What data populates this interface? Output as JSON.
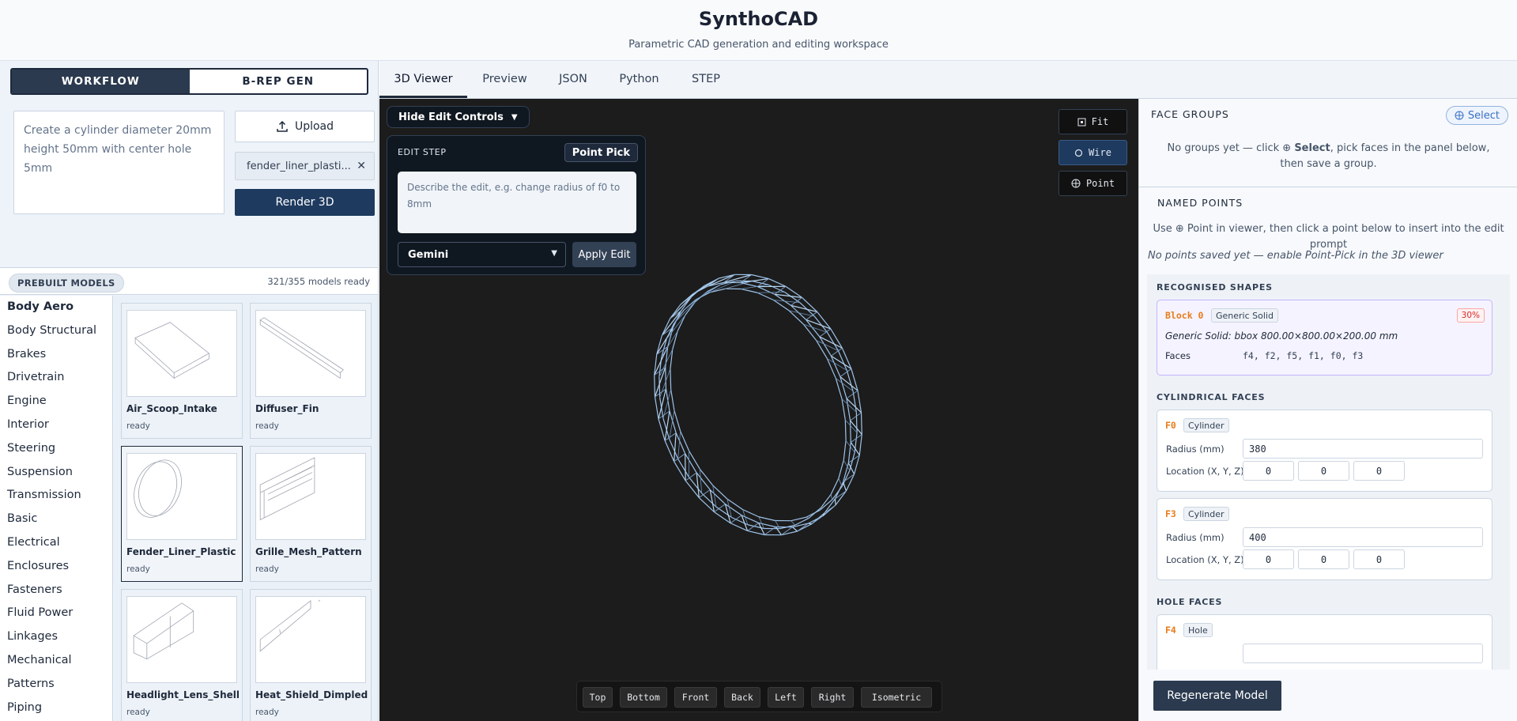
{
  "app": {
    "title": "SynthoCAD",
    "subtitle": "Parametric CAD generation and editing workspace"
  },
  "left": {
    "modes": [
      "WORKFLOW",
      "B-REP GEN"
    ],
    "prompt_text": "Create a cylinder diameter 20mm height 50mm with center hole 5mm",
    "upload_label": "Upload",
    "file_name": "fender_liner_plasti...",
    "file_remove": "✕",
    "render_label": "Render 3D",
    "prebuilt_label": "PREBUILT MODELS",
    "prebuilt_count": "321/355 models ready",
    "categories": [
      "Body Aero",
      "Body Structural",
      "Brakes",
      "Drivetrain",
      "Engine",
      "Interior",
      "Steering",
      "Suspension",
      "Transmission",
      "Basic",
      "Electrical",
      "Enclosures",
      "Fasteners",
      "Fluid Power",
      "Linkages",
      "Mechanical",
      "Patterns",
      "Piping"
    ],
    "models": [
      {
        "name": "Air_Scoop_Intake",
        "status": "ready"
      },
      {
        "name": "Diffuser_Fin",
        "status": "ready"
      },
      {
        "name": "Fender_Liner_Plastic",
        "status": "ready"
      },
      {
        "name": "Grille_Mesh_Pattern",
        "status": "ready"
      },
      {
        "name": "Headlight_Lens_Shell",
        "status": "ready"
      },
      {
        "name": "Heat_Shield_Dimpled",
        "status": "ready"
      }
    ]
  },
  "tabs": [
    "3D Viewer",
    "Preview",
    "JSON",
    "Python",
    "STEP"
  ],
  "viewer": {
    "hide_controls": "Hide Edit Controls",
    "hide_caret": "▼",
    "edit_title": "EDIT STEP",
    "point_pick": "Point Pick",
    "edit_placeholder": "Describe the edit, e.g. change radius of f0 to 8mm",
    "llm_model": "Gemini",
    "apply_label": "Apply Edit",
    "fit_label": "Fit",
    "wire_label": "Wire",
    "point_label": "Point",
    "views": [
      "Top",
      "Bottom",
      "Front",
      "Back",
      "Left",
      "Right",
      "Isometric"
    ]
  },
  "right": {
    "face_groups_title": "FACE GROUPS",
    "select_label": "Select",
    "face_groups_note_1": "No groups yet — click",
    "face_groups_note_2": "Select",
    "face_groups_note_3": ", pick faces in the panel below, then save a",
    "face_groups_note_4": "group.",
    "named_points_title": "NAMED POINTS",
    "named_points_hint_1": "Use",
    "named_points_hint_2": "Point in viewer, then click a point below to insert into the edit prompt",
    "named_points_empty": "No points saved yet — enable Point-Pick in the 3D viewer",
    "recognised_title": "RECOGNISED SHAPES",
    "block": {
      "tag": "Block 0",
      "kind": "Generic Solid",
      "pct": "30%",
      "desc": "Generic Solid: bbox 800.00×800.00×200.00 mm",
      "faces_label": "Faces",
      "faces": "f4, f2, f5, f1, f0, f3"
    },
    "cyl_title": "CYLINDRICAL FACES",
    "cyl_faces": [
      {
        "tag": "F0",
        "kind": "Cylinder",
        "radius_label": "Radius (mm)",
        "radius": "380",
        "loc_label": "Location (X, Y, Z)",
        "x": "0",
        "y": "0",
        "z": "0"
      },
      {
        "tag": "F3",
        "kind": "Cylinder",
        "radius_label": "Radius (mm)",
        "radius": "400",
        "loc_label": "Location (X, Y, Z)",
        "x": "0",
        "y": "0",
        "z": "0"
      }
    ],
    "hole_title": "HOLE FACES",
    "hole_face": {
      "tag": "F4",
      "kind": "Hole"
    },
    "regen_label": "Regenerate Model"
  }
}
